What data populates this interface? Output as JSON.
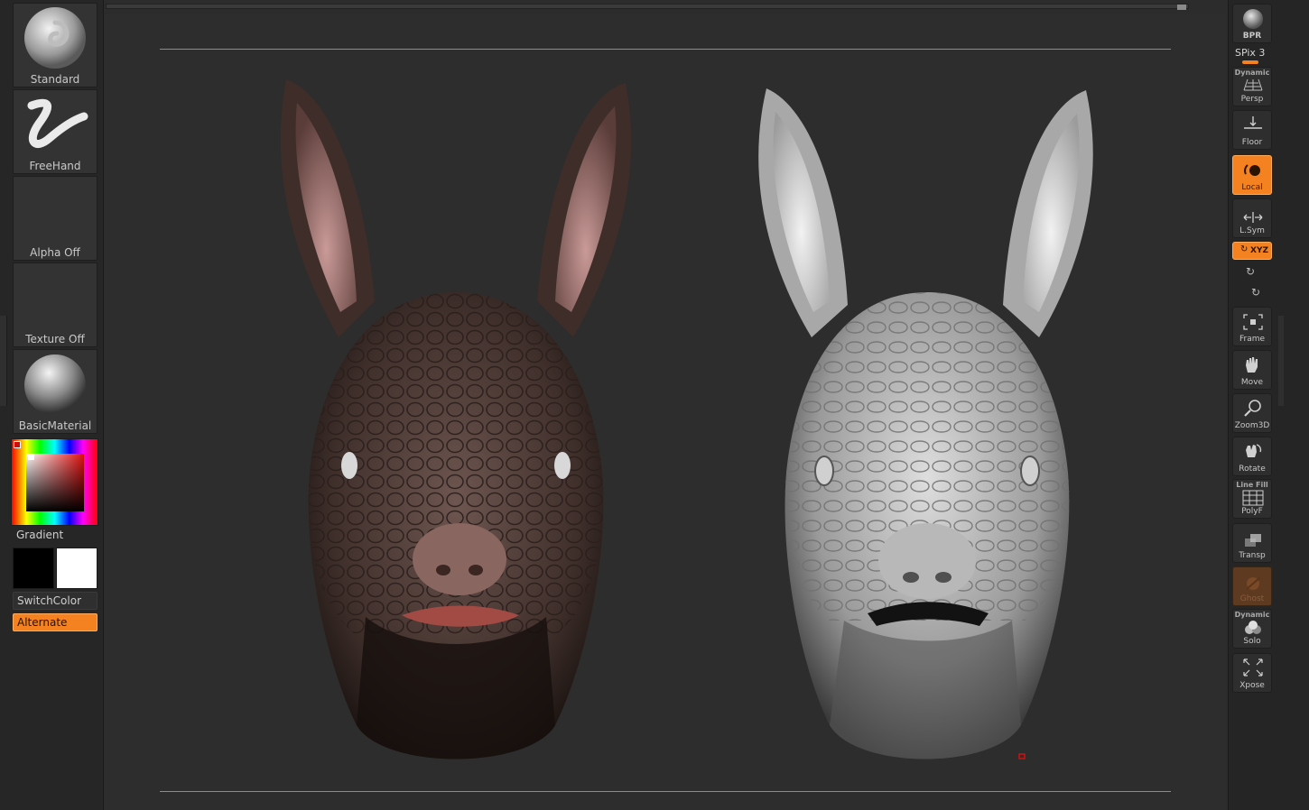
{
  "left_shelf": {
    "brush_label": "Standard",
    "stroke_label": "FreeHand",
    "alpha_label": "Alpha Off",
    "texture_label": "Texture Off",
    "material_label": "BasicMaterial",
    "gradient_label": "Gradient",
    "main_color": "#000000",
    "secondary_color": "#ffffff",
    "switch_color_label": "SwitchColor",
    "alternate_label": "Alternate"
  },
  "right_shelf": {
    "bpr_label": "BPR",
    "spix_label": "SPix 3",
    "persp_top": "Dynamic",
    "persp_label": "Persp",
    "floor_label": "Floor",
    "local_label": "Local",
    "lsym_label": "L.Sym",
    "xyz_label": "XYZ",
    "frame_label": "Frame",
    "move_label": "Move",
    "zoom3d_label": "Zoom3D",
    "rotate_label": "Rotate",
    "polyf_top": "Line Fill",
    "polyf_label": "PolyF",
    "transp_label": "Transp",
    "ghost_label": "Ghost",
    "solo_top": "Dynamic",
    "solo_label": "Solo",
    "xpose_label": "Xpose"
  },
  "colors": {
    "accent": "#f58220",
    "background": "#2d2d2d",
    "panel": "#262626"
  },
  "icons": [
    "bpr-sphere-icon",
    "persp-grid-icon",
    "floor-icon",
    "local-icon",
    "lsym-icon",
    "xyz-icon",
    "frame-icon",
    "move-hand-icon",
    "zoom-icon",
    "rotate-icon",
    "polyf-grid-icon",
    "transp-icon",
    "ghost-icon",
    "solo-icon",
    "xpose-icon"
  ]
}
